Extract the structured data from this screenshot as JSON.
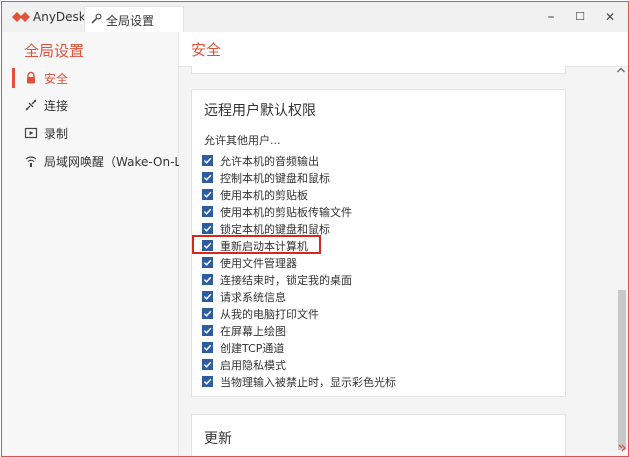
{
  "titlebar": {
    "app_name": "AnyDesk",
    "tab_label": "全局设置",
    "minimize": "–",
    "maximize": "☐",
    "close": "✕"
  },
  "sidebar": {
    "title": "全局设置",
    "items": [
      {
        "label": "安全",
        "icon": "lock-icon",
        "active": true
      },
      {
        "label": "连接",
        "icon": "connection-icon",
        "active": false
      },
      {
        "label": "录制",
        "icon": "record-icon",
        "active": false
      },
      {
        "label": "局域网唤醒（Wake-On-L...",
        "icon": "wifi-icon",
        "active": false
      }
    ]
  },
  "main": {
    "title": "安全",
    "permissions_card": {
      "title": "远程用户默认权限",
      "subtitle": "允许其他用户...",
      "items": [
        {
          "label": "允许本机的音频输出",
          "checked": true
        },
        {
          "label": "控制本机的键盘和鼠标",
          "checked": true
        },
        {
          "label": "使用本机的剪贴板",
          "checked": true
        },
        {
          "label": "使用本机的剪贴板传输文件",
          "checked": true
        },
        {
          "label": "锁定本机的键盘和鼠标",
          "checked": true
        },
        {
          "label": "重新启动本计算机",
          "checked": true
        },
        {
          "label": "使用文件管理器",
          "checked": true
        },
        {
          "label": "连接结束时，锁定我的桌面",
          "checked": true
        },
        {
          "label": "请求系统信息",
          "checked": true
        },
        {
          "label": "从我的电脑打印文件",
          "checked": true
        },
        {
          "label": "在屏幕上绘图",
          "checked": true
        },
        {
          "label": "创建TCP通道",
          "checked": true
        },
        {
          "label": "启用隐私模式",
          "checked": true
        },
        {
          "label": "当物理输入被禁止时，显示彩色光标",
          "checked": true
        }
      ]
    },
    "update_card": {
      "title": "更新"
    }
  },
  "colors": {
    "accent": "#e0523a",
    "checkbox": "#2d5d9f",
    "highlight_border": "#d9261c"
  }
}
